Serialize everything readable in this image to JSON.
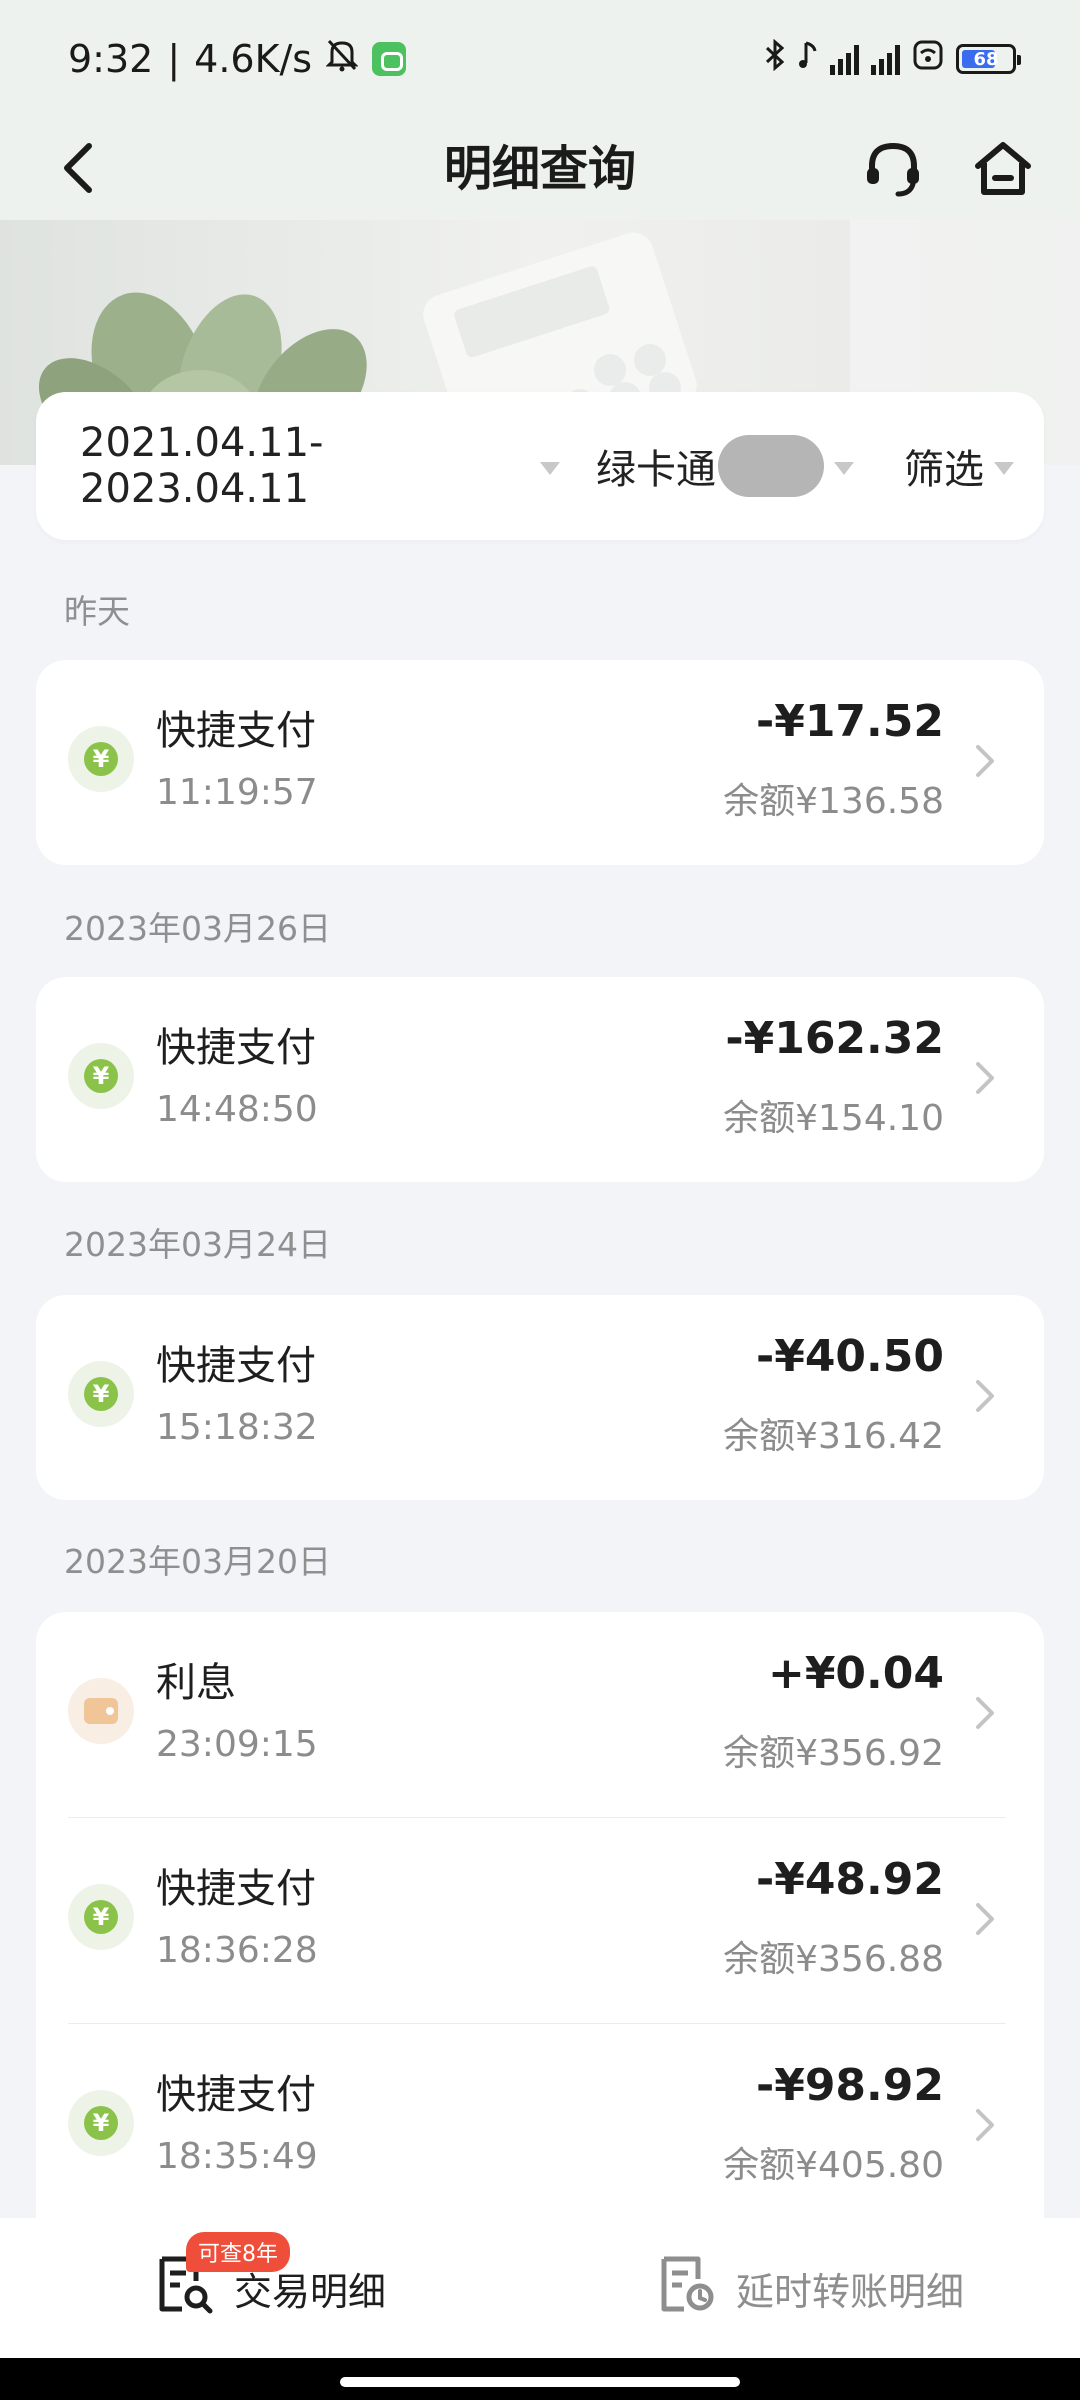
{
  "status_bar": {
    "time": "9:32",
    "net_speed": "4.6K/s",
    "battery": "68"
  },
  "header": {
    "title": "明细查询"
  },
  "filters": {
    "date_range": "2021.04.11-2023.04.11",
    "account": "绿卡通",
    "screen": "筛选"
  },
  "groups": [
    {
      "date": "昨天",
      "items": [
        {
          "name": "快捷支付",
          "time": "11:19:57",
          "amount": "-¥17.52",
          "balance": "余额¥136.58",
          "icon": "pay-icon"
        }
      ]
    },
    {
      "date": "2023年03月26日",
      "items": [
        {
          "name": "快捷支付",
          "time": "14:48:50",
          "amount": "-¥162.32",
          "balance": "余额¥154.10",
          "icon": "pay-icon"
        }
      ]
    },
    {
      "date": "2023年03月24日",
      "items": [
        {
          "name": "快捷支付",
          "time": "15:18:32",
          "amount": "-¥40.50",
          "balance": "余额¥316.42",
          "icon": "pay-icon"
        }
      ]
    },
    {
      "date": "2023年03月20日",
      "items": [
        {
          "name": "利息",
          "time": "23:09:15",
          "amount": "+¥0.04",
          "balance": "余额¥356.92",
          "icon": "wallet-icon"
        },
        {
          "name": "快捷支付",
          "time": "18:36:28",
          "amount": "-¥48.92",
          "balance": "余额¥356.88",
          "icon": "pay-icon"
        },
        {
          "name": "快捷支付",
          "time": "18:35:49",
          "amount": "-¥98.92",
          "balance": "余额¥405.80",
          "icon": "pay-icon"
        }
      ]
    }
  ],
  "bottom_tabs": {
    "transactions": "交易明细",
    "transactions_badge": "可查8年",
    "delayed_transfer": "延时转账明细"
  },
  "colors": {
    "header_bg": "#eef2ee",
    "page_bg": "#f3f4f8",
    "pay_icon": "#8bc34a",
    "badge": "#ef4e3a"
  }
}
